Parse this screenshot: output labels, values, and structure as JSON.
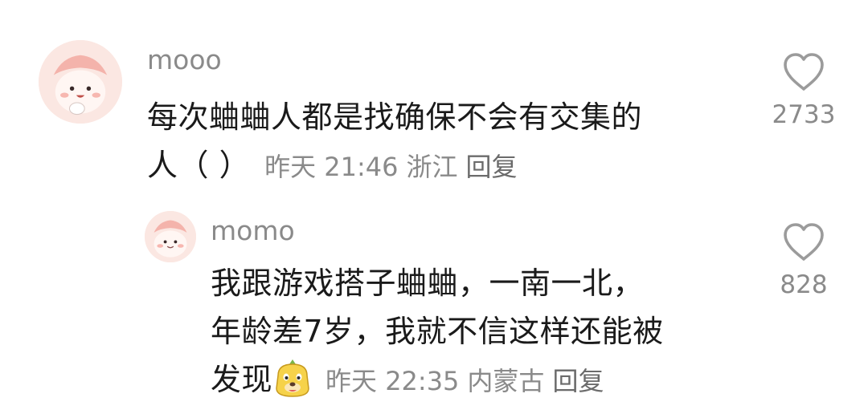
{
  "comments": [
    {
      "username": "mooo",
      "lines": [
        "每次蛐蛐人都是找确保不会有交集的",
        "人（ ）"
      ],
      "time": "昨天 21:46",
      "location": "浙江",
      "reply_label": "回复",
      "likes": "2733"
    },
    {
      "username": "momo",
      "lines": [
        "我跟游戏搭子蛐蛐，一南一北，",
        "年龄差7岁，我就不信这样还能被",
        "发现"
      ],
      "time": "昨天 22:35",
      "location": "内蒙古",
      "reply_label": "回复",
      "likes": "828"
    }
  ],
  "icons": {
    "like": "heart-outline-icon",
    "emoji": "dog-face-sticker-icon"
  },
  "colors": {
    "text": "#1a1a1a",
    "secondary": "#8a8a8a",
    "avatar_bg": "#fbe7e2",
    "avatar_accent": "#f2a8a0"
  }
}
